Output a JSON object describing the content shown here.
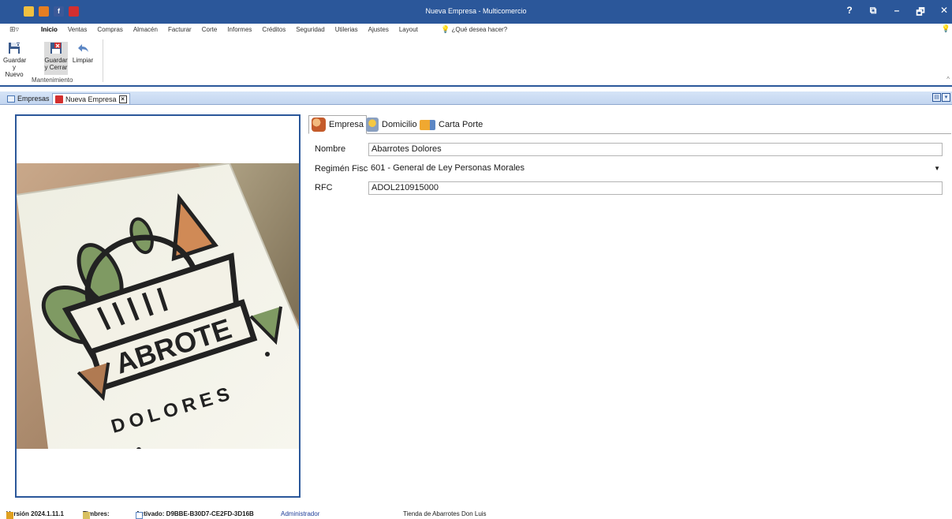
{
  "window": {
    "title": "Nueva Empresa - Multicomercio",
    "controls": [
      "?",
      "⧉",
      "–",
      "🗗",
      "✕"
    ],
    "quick_access_icons": [
      "user-icon",
      "help-hand-icon",
      "facebook-icon",
      "youtube-icon"
    ]
  },
  "menu": {
    "app_menu": "⊞▿",
    "tabs": [
      "Inicio",
      "Ventas",
      "Compras",
      "Almacén",
      "Facturar",
      "Corte",
      "Informes",
      "Créditos",
      "Seguridad",
      "Utilerias",
      "Ajustes",
      "Layout"
    ],
    "active_tab": "Inicio",
    "tell_me": "¿Qué desea hacer?"
  },
  "ribbon": {
    "buttons": [
      {
        "line1": "Guardar",
        "line2": "y Nuevo",
        "icon": "save-new-icon"
      },
      {
        "line1": "Guardar",
        "line2": "y Cerrar",
        "icon": "save-close-icon"
      },
      {
        "line1": "Limpiar",
        "line2": "",
        "icon": "undo-arrow-icon"
      }
    ],
    "group_label": "Mantenimiento"
  },
  "doc_tabs": [
    {
      "label": "Empresas",
      "icon": "list-icon"
    },
    {
      "label": "Nueva Empresa",
      "icon": "book-icon",
      "active": true
    }
  ],
  "form": {
    "tabs": [
      {
        "label": "Empresa",
        "icon": "people-icon"
      },
      {
        "label": "Domicilio",
        "icon": "map-pin-icon"
      },
      {
        "label": "Carta Porte",
        "icon": "truck-icon"
      }
    ],
    "fields": {
      "nombre_label": "Nombre",
      "nombre_value": "Abarrotes Dolores",
      "regimen_label": "Regimén Fiscal",
      "regimen_value": "601 - General de Ley Personas Morales",
      "rfc_label": "RFC",
      "rfc_value": "ADOL210915000"
    }
  },
  "logo": {
    "text_main": "ABROTE",
    "text_arc": "DOLORES"
  },
  "status": {
    "version": "Versión 2024.1.11.1",
    "timbres": "Timbres:",
    "activado": "Activado: D9BBE-B30D7-CE2FD-3D16B",
    "user": "Administrador",
    "store": "Tienda de Abarrotes Don Luis"
  },
  "colors": {
    "accent": "#2b579a",
    "user_link": "#1f3d99"
  }
}
